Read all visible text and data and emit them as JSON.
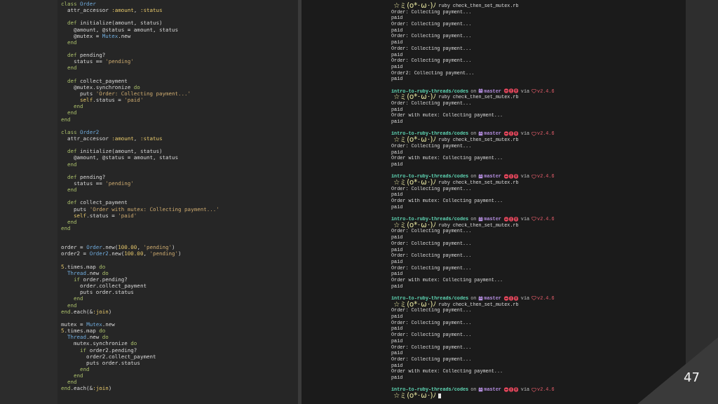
{
  "editor": {
    "lines": [
      {
        "kind": "code",
        "tokens": [
          {
            "kind": "kw",
            "text": "class "
          },
          {
            "kind": "cls",
            "text": "Order"
          }
        ]
      },
      {
        "kind": "code",
        "tokens": [
          {
            "kind": "plain",
            "text": "  attr_accessor "
          },
          {
            "kind": "sym",
            "text": ":amount"
          },
          {
            "kind": "plain",
            "text": ", "
          },
          {
            "kind": "sym",
            "text": ":status"
          }
        ]
      },
      {
        "kind": "blank"
      },
      {
        "kind": "code",
        "tokens": [
          {
            "kind": "kw",
            "text": "  def "
          },
          {
            "kind": "plain",
            "text": "initialize(amount, status)"
          }
        ]
      },
      {
        "kind": "code",
        "tokens": [
          {
            "kind": "plain",
            "text": "    @amount, @status = amount, status"
          }
        ]
      },
      {
        "kind": "code",
        "tokens": [
          {
            "kind": "plain",
            "text": "    @mutex = "
          },
          {
            "kind": "cls",
            "text": "Mutex"
          },
          {
            "kind": "plain",
            "text": ".new"
          }
        ]
      },
      {
        "kind": "code",
        "tokens": [
          {
            "kind": "kw",
            "text": "  end"
          }
        ]
      },
      {
        "kind": "blank"
      },
      {
        "kind": "code",
        "tokens": [
          {
            "kind": "kw",
            "text": "  def "
          },
          {
            "kind": "plain",
            "text": "pending?"
          }
        ]
      },
      {
        "kind": "code",
        "tokens": [
          {
            "kind": "plain",
            "text": "    status == "
          },
          {
            "kind": "str",
            "text": "'pending'"
          }
        ]
      },
      {
        "kind": "code",
        "tokens": [
          {
            "kind": "kw",
            "text": "  end"
          }
        ]
      },
      {
        "kind": "blank"
      },
      {
        "kind": "code",
        "tokens": [
          {
            "kind": "kw",
            "text": "  def "
          },
          {
            "kind": "plain",
            "text": "collect_payment"
          }
        ]
      },
      {
        "kind": "code",
        "tokens": [
          {
            "kind": "plain",
            "text": "    @mutex.synchronize "
          },
          {
            "kind": "kw",
            "text": "do"
          }
        ]
      },
      {
        "kind": "code",
        "tokens": [
          {
            "kind": "plain",
            "text": "      puts "
          },
          {
            "kind": "str",
            "text": "'Order: Collecting payment...'"
          }
        ]
      },
      {
        "kind": "code",
        "tokens": [
          {
            "kind": "sym",
            "text": "      self"
          },
          {
            "kind": "plain",
            "text": ".status = "
          },
          {
            "kind": "str",
            "text": "'paid'"
          }
        ]
      },
      {
        "kind": "code",
        "tokens": [
          {
            "kind": "kw",
            "text": "    end"
          }
        ]
      },
      {
        "kind": "code",
        "tokens": [
          {
            "kind": "kw",
            "text": "  end"
          }
        ]
      },
      {
        "kind": "code",
        "tokens": [
          {
            "kind": "kw",
            "text": "end"
          }
        ]
      },
      {
        "kind": "blank"
      },
      {
        "kind": "code",
        "tokens": [
          {
            "kind": "kw",
            "text": "class "
          },
          {
            "kind": "cls",
            "text": "Order2"
          }
        ]
      },
      {
        "kind": "code",
        "tokens": [
          {
            "kind": "plain",
            "text": "  attr_accessor "
          },
          {
            "kind": "sym",
            "text": ":amount"
          },
          {
            "kind": "plain",
            "text": ", "
          },
          {
            "kind": "sym",
            "text": ":status"
          }
        ]
      },
      {
        "kind": "blank"
      },
      {
        "kind": "code",
        "tokens": [
          {
            "kind": "kw",
            "text": "  def "
          },
          {
            "kind": "plain",
            "text": "initialize(amount, status)"
          }
        ]
      },
      {
        "kind": "code",
        "tokens": [
          {
            "kind": "plain",
            "text": "    @amount, @status = amount, status"
          }
        ]
      },
      {
        "kind": "code",
        "tokens": [
          {
            "kind": "kw",
            "text": "  end"
          }
        ]
      },
      {
        "kind": "blank"
      },
      {
        "kind": "code",
        "tokens": [
          {
            "kind": "kw",
            "text": "  def "
          },
          {
            "kind": "plain",
            "text": "pending?"
          }
        ]
      },
      {
        "kind": "code",
        "tokens": [
          {
            "kind": "plain",
            "text": "    status == "
          },
          {
            "kind": "str",
            "text": "'pending'"
          }
        ]
      },
      {
        "kind": "code",
        "tokens": [
          {
            "kind": "kw",
            "text": "  end"
          }
        ]
      },
      {
        "kind": "blank"
      },
      {
        "kind": "code",
        "tokens": [
          {
            "kind": "kw",
            "text": "  def "
          },
          {
            "kind": "plain",
            "text": "collect_payment"
          }
        ]
      },
      {
        "kind": "code",
        "tokens": [
          {
            "kind": "plain",
            "text": "    puts "
          },
          {
            "kind": "str",
            "text": "'Order with mutex: Collecting payment...'"
          }
        ]
      },
      {
        "kind": "code",
        "tokens": [
          {
            "kind": "sym",
            "text": "    self"
          },
          {
            "kind": "plain",
            "text": ".status = "
          },
          {
            "kind": "str",
            "text": "'paid'"
          }
        ]
      },
      {
        "kind": "code",
        "tokens": [
          {
            "kind": "kw",
            "text": "  end"
          }
        ]
      },
      {
        "kind": "code",
        "tokens": [
          {
            "kind": "kw",
            "text": "end"
          }
        ]
      },
      {
        "kind": "blank"
      },
      {
        "kind": "blank"
      },
      {
        "kind": "code",
        "tokens": [
          {
            "kind": "plain",
            "text": "order = "
          },
          {
            "kind": "cls",
            "text": "Order"
          },
          {
            "kind": "plain",
            "text": ".new("
          },
          {
            "kind": "sym",
            "text": "100.00"
          },
          {
            "kind": "plain",
            "text": ", "
          },
          {
            "kind": "str",
            "text": "'pending'"
          },
          {
            "kind": "plain",
            "text": ")"
          }
        ]
      },
      {
        "kind": "code",
        "tokens": [
          {
            "kind": "plain",
            "text": "order2 = "
          },
          {
            "kind": "cls",
            "text": "Order2"
          },
          {
            "kind": "plain",
            "text": ".new("
          },
          {
            "kind": "sym",
            "text": "100.00"
          },
          {
            "kind": "plain",
            "text": ", "
          },
          {
            "kind": "str",
            "text": "'pending'"
          },
          {
            "kind": "plain",
            "text": ")"
          }
        ]
      },
      {
        "kind": "blank"
      },
      {
        "kind": "code",
        "tokens": [
          {
            "kind": "sym",
            "text": "5"
          },
          {
            "kind": "plain",
            "text": ".times.map "
          },
          {
            "kind": "kw",
            "text": "do"
          }
        ]
      },
      {
        "kind": "code",
        "tokens": [
          {
            "kind": "cls",
            "text": "  Thread"
          },
          {
            "kind": "plain",
            "text": ".new "
          },
          {
            "kind": "kw",
            "text": "do"
          }
        ]
      },
      {
        "kind": "code",
        "tokens": [
          {
            "kind": "kw",
            "text": "    if "
          },
          {
            "kind": "plain",
            "text": "order.pending?"
          }
        ]
      },
      {
        "kind": "code",
        "tokens": [
          {
            "kind": "plain",
            "text": "      order.collect_payment"
          }
        ]
      },
      {
        "kind": "code",
        "tokens": [
          {
            "kind": "plain",
            "text": "      puts order.status"
          }
        ]
      },
      {
        "kind": "code",
        "tokens": [
          {
            "kind": "kw",
            "text": "    end"
          }
        ]
      },
      {
        "kind": "code",
        "tokens": [
          {
            "kind": "kw",
            "text": "  end"
          }
        ]
      },
      {
        "kind": "code",
        "tokens": [
          {
            "kind": "kw",
            "text": "end"
          },
          {
            "kind": "plain",
            "text": ".each(&"
          },
          {
            "kind": "sym",
            "text": ":join"
          },
          {
            "kind": "plain",
            "text": ")"
          }
        ]
      },
      {
        "kind": "blank"
      },
      {
        "kind": "code",
        "tokens": [
          {
            "kind": "plain",
            "text": "mutex = "
          },
          {
            "kind": "cls",
            "text": "Mutex"
          },
          {
            "kind": "plain",
            "text": ".new"
          }
        ]
      },
      {
        "kind": "code",
        "tokens": [
          {
            "kind": "sym",
            "text": "5"
          },
          {
            "kind": "plain",
            "text": ".times.map "
          },
          {
            "kind": "kw",
            "text": "do"
          }
        ]
      },
      {
        "kind": "code",
        "tokens": [
          {
            "kind": "cls",
            "text": "  Thread"
          },
          {
            "kind": "plain",
            "text": ".new "
          },
          {
            "kind": "kw",
            "text": "do"
          }
        ]
      },
      {
        "kind": "code",
        "tokens": [
          {
            "kind": "plain",
            "text": "    mutex.synchronize "
          },
          {
            "kind": "kw",
            "text": "do"
          }
        ]
      },
      {
        "kind": "code",
        "tokens": [
          {
            "kind": "kw",
            "text": "      if "
          },
          {
            "kind": "plain",
            "text": "order2.pending?"
          }
        ]
      },
      {
        "kind": "code",
        "tokens": [
          {
            "kind": "plain",
            "text": "        order2.collect_payment"
          }
        ]
      },
      {
        "kind": "code",
        "tokens": [
          {
            "kind": "plain",
            "text": "        puts order.status"
          }
        ]
      },
      {
        "kind": "code",
        "tokens": [
          {
            "kind": "kw",
            "text": "      end"
          }
        ]
      },
      {
        "kind": "code",
        "tokens": [
          {
            "kind": "kw",
            "text": "    end"
          }
        ]
      },
      {
        "kind": "code",
        "tokens": [
          {
            "kind": "kw",
            "text": "  end"
          }
        ]
      },
      {
        "kind": "code",
        "tokens": [
          {
            "kind": "kw",
            "text": "end"
          },
          {
            "kind": "plain",
            "text": ".each(&"
          },
          {
            "kind": "sym",
            "text": ":join"
          },
          {
            "kind": "plain",
            "text": ")"
          }
        ]
      }
    ]
  },
  "terminal": {
    "lines": [
      {
        "kind": "command",
        "prompt": "☆ミ(o*･ω･)ﾉ",
        "text": "ruby check_then_set_mutex.rb"
      },
      {
        "kind": "output",
        "text": "Order: Collecting payment..."
      },
      {
        "kind": "output",
        "text": "paid"
      },
      {
        "kind": "output",
        "text": "Order: Collecting payment..."
      },
      {
        "kind": "output",
        "text": "paid"
      },
      {
        "kind": "output",
        "text": "Order: Collecting payment..."
      },
      {
        "kind": "output",
        "text": "paid"
      },
      {
        "kind": "output",
        "text": "Order: Collecting payment..."
      },
      {
        "kind": "output",
        "text": "paid"
      },
      {
        "kind": "output",
        "text": "Order: Collecting payment..."
      },
      {
        "kind": "output",
        "text": "paid"
      },
      {
        "kind": "output",
        "text": "Order2: Collecting payment..."
      },
      {
        "kind": "output",
        "text": "paid"
      },
      {
        "kind": "blank"
      },
      {
        "kind": "header",
        "path": "intro-to-ruby-threads/codes",
        "on": "on",
        "branch": "master",
        "via": "via",
        "version": "v2.4.6"
      },
      {
        "kind": "command",
        "prompt": "☆ミ(o*･ω･)ﾉ",
        "text": "ruby check_then_set_mutex.rb"
      },
      {
        "kind": "output",
        "text": "Order: Collecting payment..."
      },
      {
        "kind": "output",
        "text": "paid"
      },
      {
        "kind": "output",
        "text": "Order with mutex: Collecting payment..."
      },
      {
        "kind": "output",
        "text": "paid"
      },
      {
        "kind": "blank"
      },
      {
        "kind": "header",
        "path": "intro-to-ruby-threads/codes",
        "on": "on",
        "branch": "master",
        "via": "via",
        "version": "v2.4.6"
      },
      {
        "kind": "command",
        "prompt": "☆ミ(o*･ω･)ﾉ",
        "text": "ruby check_then_set_mutex.rb"
      },
      {
        "kind": "output",
        "text": "Order: Collecting payment..."
      },
      {
        "kind": "output",
        "text": "paid"
      },
      {
        "kind": "output",
        "text": "Order with mutex: Collecting payment..."
      },
      {
        "kind": "output",
        "text": "paid"
      },
      {
        "kind": "blank"
      },
      {
        "kind": "header",
        "path": "intro-to-ruby-threads/codes",
        "on": "on",
        "branch": "master",
        "via": "via",
        "version": "v2.4.6"
      },
      {
        "kind": "command",
        "prompt": "☆ミ(o*･ω･)ﾉ",
        "text": "ruby check_then_set_mutex.rb"
      },
      {
        "kind": "output",
        "text": "Order: Collecting payment..."
      },
      {
        "kind": "output",
        "text": "paid"
      },
      {
        "kind": "output",
        "text": "Order with mutex: Collecting payment..."
      },
      {
        "kind": "output",
        "text": "paid"
      },
      {
        "kind": "blank"
      },
      {
        "kind": "header",
        "path": "intro-to-ruby-threads/codes",
        "on": "on",
        "branch": "master",
        "via": "via",
        "version": "v2.4.6"
      },
      {
        "kind": "command",
        "prompt": "☆ミ(o*･ω･)ﾉ",
        "text": "ruby check_then_set_mutex.rb"
      },
      {
        "kind": "output",
        "text": "Order: Collecting payment..."
      },
      {
        "kind": "output",
        "text": "paid"
      },
      {
        "kind": "output",
        "text": "Order: Collecting payment..."
      },
      {
        "kind": "output",
        "text": "paid"
      },
      {
        "kind": "output",
        "text": "Order: Collecting payment..."
      },
      {
        "kind": "output",
        "text": "paid"
      },
      {
        "kind": "output",
        "text": "Order: Collecting payment..."
      },
      {
        "kind": "output",
        "text": "paid"
      },
      {
        "kind": "output",
        "text": "Order with mutex: Collecting payment..."
      },
      {
        "kind": "output",
        "text": "paid"
      },
      {
        "kind": "blank"
      },
      {
        "kind": "header",
        "path": "intro-to-ruby-threads/codes",
        "on": "on",
        "branch": "master",
        "via": "via",
        "version": "v2.4.6"
      },
      {
        "kind": "command",
        "prompt": "☆ミ(o*･ω･)ﾉ",
        "text": "ruby check_then_set_mutex.rb"
      },
      {
        "kind": "output",
        "text": "Order: Collecting payment..."
      },
      {
        "kind": "output",
        "text": "paid"
      },
      {
        "kind": "output",
        "text": "Order: Collecting payment..."
      },
      {
        "kind": "output",
        "text": "paid"
      },
      {
        "kind": "output",
        "text": "Order: Collecting payment..."
      },
      {
        "kind": "output",
        "text": "paid"
      },
      {
        "kind": "output",
        "text": "Order: Collecting payment..."
      },
      {
        "kind": "output",
        "text": "paid"
      },
      {
        "kind": "output",
        "text": "Order: Collecting payment..."
      },
      {
        "kind": "output",
        "text": "paid"
      },
      {
        "kind": "output",
        "text": "Order with mutex: Collecting payment..."
      },
      {
        "kind": "output",
        "text": "paid"
      },
      {
        "kind": "blank"
      },
      {
        "kind": "header",
        "path": "intro-to-ruby-threads/codes",
        "on": "on",
        "branch": "master",
        "via": "via",
        "version": "v2.4.6"
      },
      {
        "kind": "prompt",
        "prompt": "☆ミ(o*･ω･)ﾉ"
      }
    ]
  },
  "slide_number": "47"
}
